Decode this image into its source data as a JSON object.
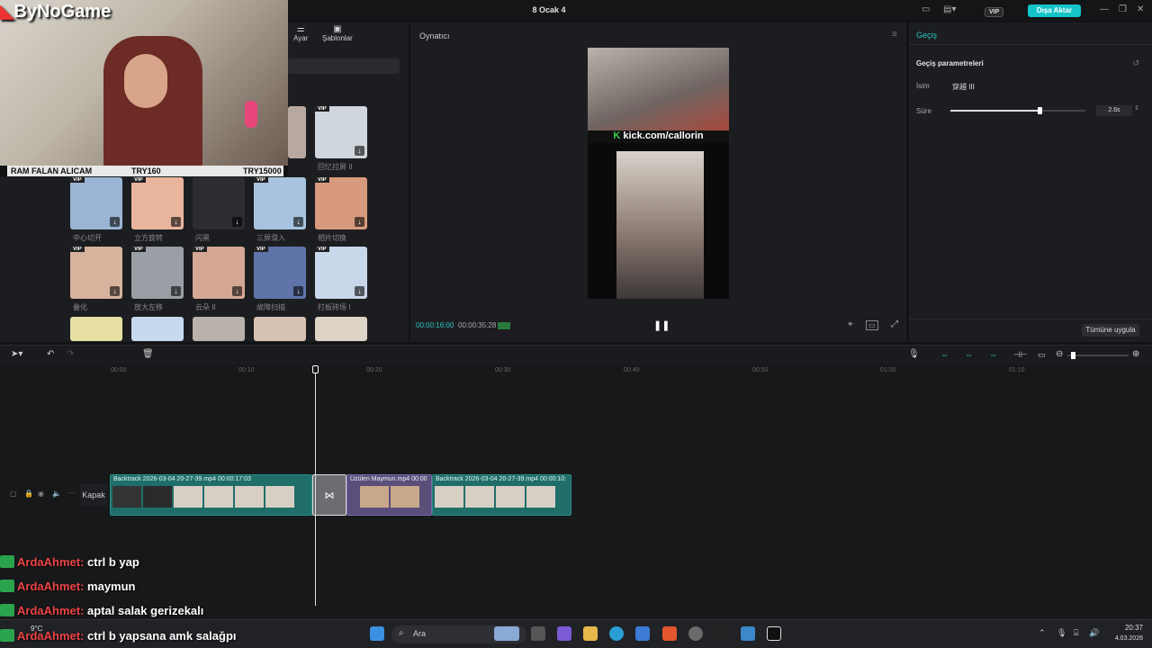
{
  "window": {
    "title": "8 Ocak 4",
    "export_label": "Dışa Aktar",
    "vip": "VIP"
  },
  "media": {
    "tabs": [
      {
        "label": "Ayar"
      },
      {
        "label": "Şablonlar"
      }
    ],
    "items": [
      {
        "label": "回忆拉屏 II",
        "color": "#cfd6dd",
        "vip": true
      },
      {
        "label": "中心切开",
        "color": "#9ab4d4",
        "vip": true
      },
      {
        "label": "立方旋转",
        "color": "#e9b59c",
        "vip": true
      },
      {
        "label": "闪黑",
        "color": "#2b2d33",
        "vip": true
      },
      {
        "label": "三屏滑入",
        "color": "#a8c3e0",
        "vip": true
      },
      {
        "label": "相片切换",
        "color": "#d89a7e",
        "vip": true
      },
      {
        "label": "叠化",
        "color": "#d7b39e",
        "vip": true
      },
      {
        "label": "放大左移",
        "color": "#9a9ea5",
        "vip": true
      },
      {
        "label": "云朵 II",
        "color": "#d4a894",
        "vip": true
      },
      {
        "label": "故障扫描",
        "color": "#5f74a8",
        "vip": true
      },
      {
        "label": "打板砖场 I",
        "color": "#c9d7ea",
        "vip": true
      }
    ]
  },
  "player": {
    "header": "Oynatıcı",
    "current_time": "00:00:16:00",
    "total_time": "00:00:35:28",
    "overlay_text": "kick.com/callorin"
  },
  "inspector": {
    "tab": "Geçiş",
    "section": "Geçiş parametreleri",
    "name_label": "İsim",
    "name_value": "穿越 III",
    "duration_label": "Süre",
    "duration_value": "2.6s",
    "duration_fraction": 0.66,
    "apply_all": "Tümüne uygula"
  },
  "timeline": {
    "ticks": [
      "00:00",
      "00:10",
      "00:20",
      "00:30",
      "00:40",
      "00:50",
      "01:00",
      "01:10"
    ],
    "track_label": "Kapak",
    "clips": [
      {
        "name": "Backtrack 2026-03-04 20-27-39.mp4   00:00:17:03"
      },
      {
        "name": "Üzülen Maymun.mp4   00:00"
      },
      {
        "name": "Backtrack 2026-03-04 20-27-39.mp4   00:00:10:"
      }
    ]
  },
  "stream": {
    "logo": "ByNoGame",
    "banner": {
      "left": "RAM FALAN ALICAM",
      "mid": "TRY160",
      "right": "TRY15000"
    },
    "chat": [
      {
        "user": "ArdaAhmet:",
        "msg": "ctrl b yap"
      },
      {
        "user": "ArdaAhmet:",
        "msg": "maymun"
      },
      {
        "user": "ArdaAhmet:",
        "msg": "aptal salak gerizekalı"
      },
      {
        "user": "ArdaAhmet:",
        "msg": "ctrl b yapsana amk salağpı"
      }
    ]
  },
  "taskbar": {
    "weather": "9°C",
    "search": "Ara",
    "time": "20:37",
    "date": "4.03.2026"
  }
}
